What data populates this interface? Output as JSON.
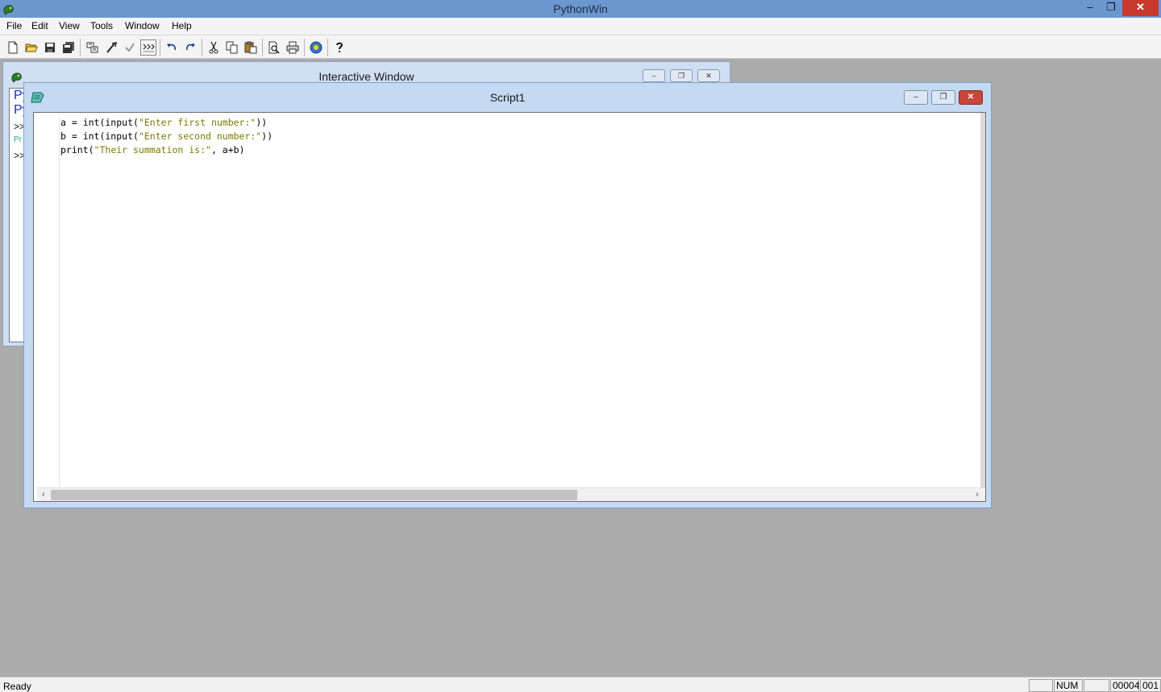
{
  "app": {
    "title": "PythonWin"
  },
  "menu": [
    "File",
    "Edit",
    "View",
    "Tools",
    "Window",
    "Help"
  ],
  "toolbar": {
    "buttons": [
      "new-file",
      "open-folder",
      "save",
      "save-all",
      "browse",
      "run",
      "check",
      "indent-guide",
      "undo",
      "redo",
      "cut",
      "copy",
      "paste",
      "print-preview",
      "print",
      "python-web",
      "help"
    ]
  },
  "interactive_window": {
    "title": "Interactive Window",
    "lines": [
      "Py",
      "Py",
      ">>",
      "Pr",
      ">>"
    ]
  },
  "script_window": {
    "title": "Script1",
    "code": [
      {
        "pre": "a = int(input(",
        "str": "\"Enter first number:\"",
        "post": "))"
      },
      {
        "pre": "b = int(input(",
        "str": "\"Enter second number:\"",
        "post": "))"
      },
      {
        "pre": "print(",
        "str": "\"Their summation is:\"",
        "post": ", a+b)"
      }
    ]
  },
  "statusbar": {
    "text": "Ready",
    "num": "NUM",
    "line": "00004",
    "col": "001"
  },
  "colors": {
    "titlebar": "#6b97cf",
    "string": "#7a7a00",
    "close_button": "#c7392e"
  }
}
